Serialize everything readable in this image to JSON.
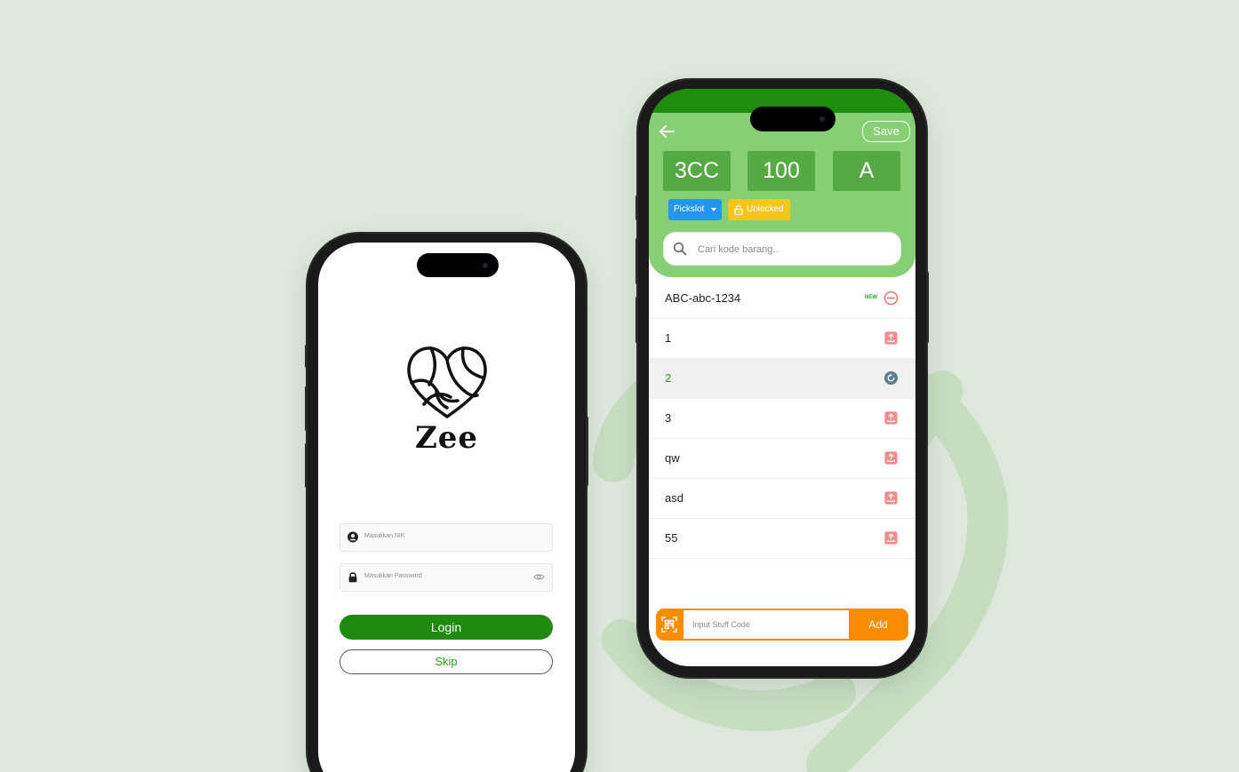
{
  "login": {
    "brand": "Zee",
    "nik_placeholder": "Masukkan NIK",
    "password_placeholder": "Masukkan Password",
    "login_label": "Login",
    "skip_label": "Skip"
  },
  "stock": {
    "save_label": "Save",
    "tiles": [
      "3CC",
      "100",
      "A"
    ],
    "pickslot_label": "Pickslot",
    "lock_status": "Unlocked",
    "search_placeholder": "Cari kode barang..",
    "items": [
      {
        "label": "ABC-abc-1234",
        "badge": "NEW",
        "icon": "remove-circle-icon"
      },
      {
        "label": "1",
        "icon": "upload-tray-icon"
      },
      {
        "label": "2",
        "icon": "refresh-icon",
        "active": true
      },
      {
        "label": "3",
        "icon": "upload-tray-icon"
      },
      {
        "label": "qw",
        "icon": "upload-tray-icon"
      },
      {
        "label": "asd",
        "icon": "upload-tray-icon"
      },
      {
        "label": "55",
        "icon": "upload-tray-icon"
      }
    ],
    "stuff_code_placeholder": "Input Stuff Code",
    "add_label": "Add"
  },
  "colors": {
    "background": "#dde7db",
    "primary_green": "#1f8a0f",
    "header_green": "#86cf74",
    "tile_green": "#55aa44",
    "pickslot_blue": "#2196f3",
    "unlocked_yellow": "#f5c518",
    "add_orange": "#fb8c00",
    "remove_red": "#ef6b6b"
  }
}
